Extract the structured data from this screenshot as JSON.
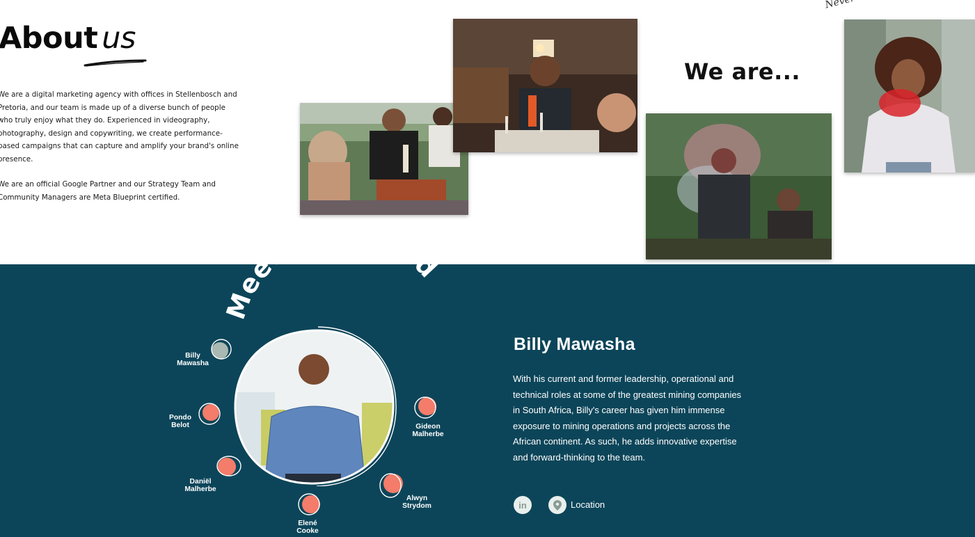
{
  "about": {
    "title_bold": "About",
    "title_italic": "us",
    "paragraph_1": "We are a digital marketing agency with offices in Stellenbosch and Pretoria, and our team is made up of a diverse bunch of people who truly enjoy what they do. Experienced in videography, photography, design and copywriting, we create performance-based campaigns that can capture and amplify your brand's online presence.",
    "paragraph_2": "We are an official Google Partner and our Strategy Team and Community Managers are Meta Blueprint certified.",
    "we_are": "We are...",
    "tagline": "Never boring"
  },
  "board": {
    "heading": "Meet our board",
    "members": [
      {
        "line1": "Billy",
        "line2": "Mawasha"
      },
      {
        "line1": "Pondo",
        "line2": "Belot"
      },
      {
        "line1": "Daniël",
        "line2": "Malherbe"
      },
      {
        "line1": "Elené",
        "line2": "Cooke"
      },
      {
        "line1": "Alwyn",
        "line2": "Strydom"
      },
      {
        "line1": "Gideon",
        "line2": "Malherbe"
      }
    ],
    "selected": {
      "name": "Billy Mawasha",
      "bio": "With his current and former leadership, operational and technical roles at some of the greatest mining companies in South Africa, Billy's career has given him immense exposure to mining operations and projects across the African continent. As such, he adds innovative expertise and forward-thinking to the team.",
      "linkedin_icon": "in",
      "location_label": "Location"
    },
    "colors": {
      "background": "#0c4559",
      "dot_active": "#a9b8b2",
      "dot_inactive": "#f47c6a"
    }
  }
}
